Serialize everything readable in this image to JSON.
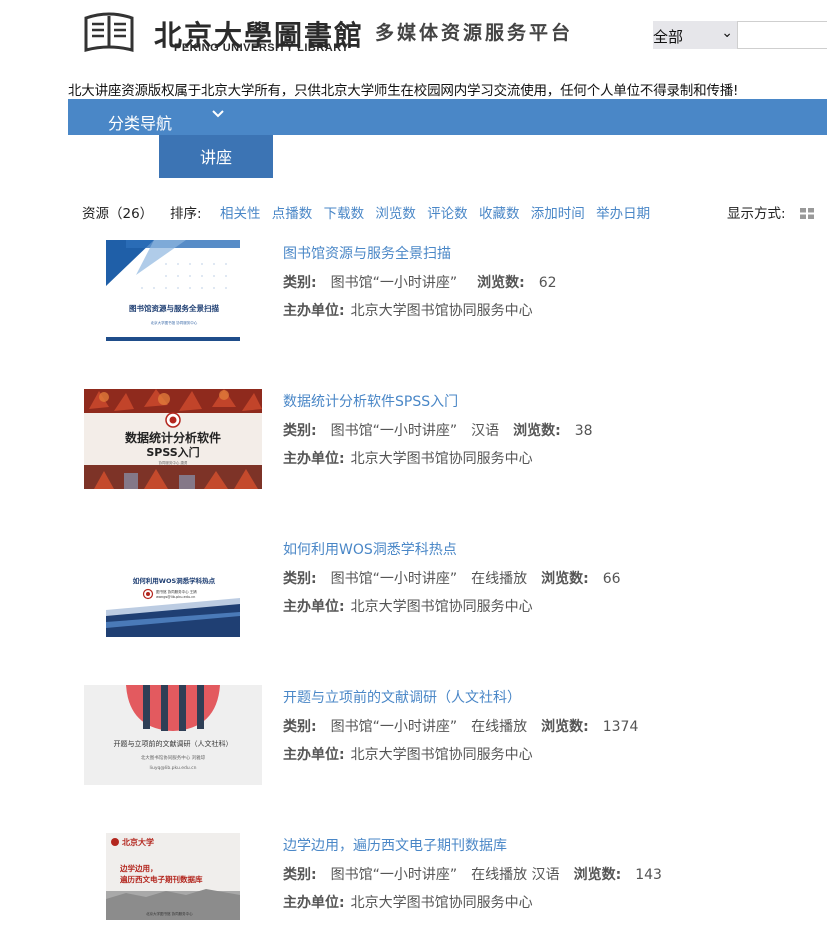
{
  "header": {
    "logo_title": "北京大學圖書館",
    "logo_en": "PEKING UNIVERSITY LIBRARY",
    "logo_subtitle": "多媒体资源服务平台",
    "search_scope": "全部",
    "search_placeholder": ""
  },
  "notice": "北大讲座资源版权属于北京大学所有，只供北京大学师生在校园网内学习交流使用，任何个人单位不得录制和传播!",
  "nav": {
    "category_label": "分类导航",
    "sub_tab": "讲座"
  },
  "toolbar": {
    "resource_count": "资源（26）",
    "sort_label": "排序:",
    "sort_options": [
      "相关性",
      "点播数",
      "下载数",
      "浏览数",
      "评论数",
      "收藏数",
      "添加时间",
      "举办日期"
    ],
    "display_label": "显示方式:"
  },
  "labels": {
    "category": "类别:",
    "views": "浏览数:",
    "organizer": "主办单位:"
  },
  "items": [
    {
      "title": "图书馆资源与服务全景扫描",
      "category": "图书馆“一小时讲座”",
      "tags": "",
      "views": "62",
      "organizer": "北京大学图书馆协同服务中心",
      "thumb_text": "图书馆资源与服务全景扫描",
      "thumb_sub": "北京大学图书馆 协同服务中心"
    },
    {
      "title": "数据统计分析软件SPSS入门",
      "category": "图书馆“一小时讲座”",
      "tags": "汉语",
      "views": "38",
      "organizer": "北京大学图书馆协同服务中心",
      "thumb_text": "数据统计分析软件",
      "thumb_text2": "SPSS入门",
      "thumb_sub": "协同服务中心 唐勇"
    },
    {
      "title": "如何利用WOS洞悉学科热点",
      "category": "图书馆“一小时讲座”",
      "tags": "在线播放",
      "views": "66",
      "organizer": "北京大学图书馆协同服务中心",
      "thumb_text": "如何利用WOS洞悉学科热点",
      "thumb_sub": "图书馆 协同服务中心 王婧",
      "thumb_sub2": "wangs@lib.pku.edu.cn"
    },
    {
      "title": "开题与立项前的文献调研（人文社科）",
      "category": "图书馆“一小时讲座”",
      "tags": "在线播放",
      "views": "1374",
      "organizer": "北京大学图书馆协同服务中心",
      "thumb_text": "开题与立项前的文献调研（人文社科）",
      "thumb_sub": "北大图书馆协同服务中心 刘雅琼",
      "thumb_sub2": "liuyq@lib.pku.edu.cn"
    },
    {
      "title": "边学边用，遍历西文电子期刊数据库",
      "category": "图书馆“一小时讲座”",
      "tags": "在线播放 汉语",
      "views": "143",
      "organizer": "北京大学图书馆协同服务中心",
      "thumb_text": "边学边用，",
      "thumb_text2": "遍历西文电子期刊数据库",
      "thumb_sub": "北京大学图书馆 协同服务中心",
      "thumb_logo": "北京大学"
    }
  ]
}
